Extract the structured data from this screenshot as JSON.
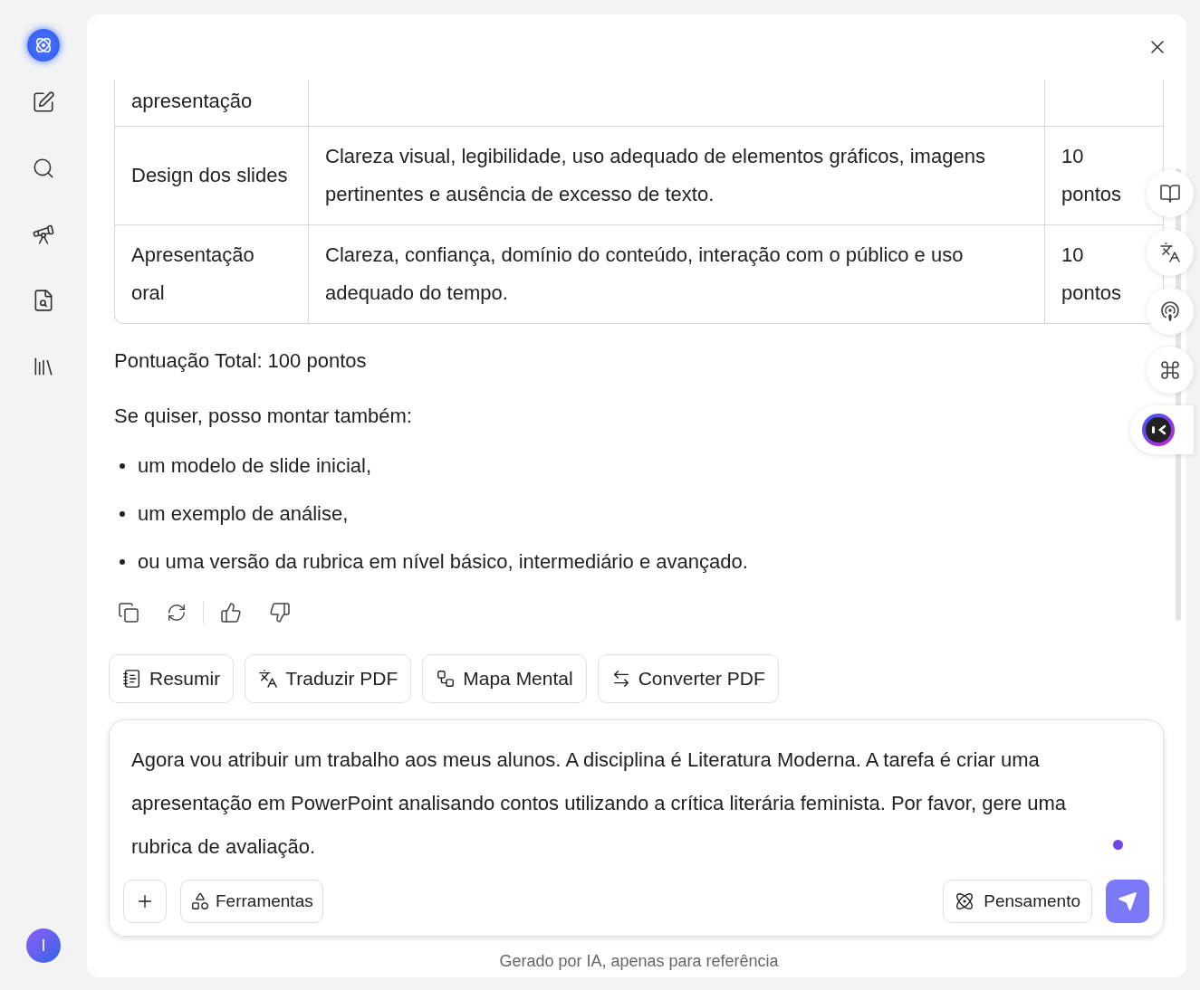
{
  "sidebar": {
    "avatar": "I"
  },
  "table": {
    "rows": [
      {
        "criterion": "apresentação",
        "description": "",
        "points": "",
        "cut": true
      },
      {
        "criterion": "Design dos slides",
        "description": "Clareza visual, legibilidade, uso adequado de elementos gráficos, imagens pertinentes e ausência de excesso de texto.",
        "points": "10 pontos",
        "cut": false
      },
      {
        "criterion": "Apresentação oral",
        "description": "Clareza, confiança, domínio do conteúdo, interação com o público e uso adequado do tempo.",
        "points": "10 pontos",
        "cut": false
      }
    ]
  },
  "total": "Pontuação Total: 100 pontos",
  "intro": "Se quiser, posso montar também:",
  "bullets": [
    "um modelo de slide inicial,",
    "um exemplo de análise,",
    "ou uma versão da rubrica em nível básico, intermediário e avançado."
  ],
  "chips": [
    {
      "kind": "summary",
      "label": "Resumir"
    },
    {
      "kind": "translate",
      "label": "Traduzir PDF"
    },
    {
      "kind": "mindmap",
      "label": "Mapa Mental"
    },
    {
      "kind": "convert",
      "label": "Converter PDF"
    }
  ],
  "input": {
    "value": "Agora vou atribuir um trabalho aos meus alunos. A disciplina é Literatura Moderna. A tarefa é criar uma apresentação em PowerPoint analisando contos utilizando a crítica literária feminista. Por favor, gere uma rubrica de avaliação."
  },
  "tools_button": "Ferramentas",
  "thinking_button": "Pensamento",
  "footer": "Gerado por IA, apenas para referência"
}
